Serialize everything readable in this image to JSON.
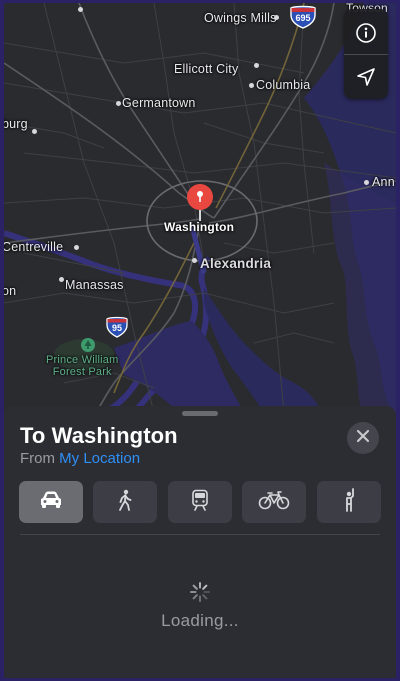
{
  "map": {
    "labels": {
      "owings_mills": "Owings Mills",
      "towson": "Towson",
      "ellicott_city": "Ellicott City",
      "columbia": "Columbia",
      "germantown": "Germantown",
      "gaithersburg_partial": "burg",
      "annapolis_partial": "Ann",
      "washington": "Washington",
      "centreville": "Centreville",
      "alexandria": "Alexandria",
      "manassas": "Manassas",
      "left_partial": "on",
      "prince_william_line1": "Prince William",
      "prince_william_line2": "Forest Park"
    },
    "shields": {
      "i695": "695",
      "i95": "95"
    }
  },
  "controls": {
    "info_icon": "info-icon",
    "location_icon": "location-arrow-icon"
  },
  "sheet": {
    "title": "To Washington",
    "from_label": "From",
    "from_value": "My Location",
    "modes": [
      {
        "name": "drive",
        "icon": "car-icon",
        "selected": true
      },
      {
        "name": "walk",
        "icon": "walking-icon",
        "selected": false
      },
      {
        "name": "transit",
        "icon": "train-icon",
        "selected": false
      },
      {
        "name": "cycle",
        "icon": "bicycle-icon",
        "selected": false
      },
      {
        "name": "ride",
        "icon": "hailing-person-icon",
        "selected": false
      }
    ],
    "loading": "Loading..."
  },
  "colors": {
    "accent": "#2f8ff6",
    "pin": "#e8483f",
    "sheet": "#2c2d33",
    "map_bg": "#2a2b2f",
    "water": "#2b2a5c",
    "park": "#2c3a32"
  }
}
